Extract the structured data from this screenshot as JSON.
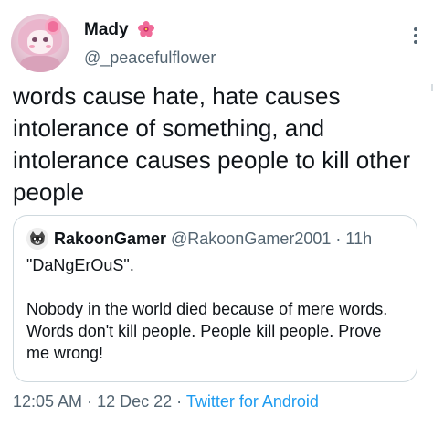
{
  "author": {
    "display_name": "Mady",
    "handle": "@_peacefulflower",
    "name_emoji": "hibiscus-flower"
  },
  "tweet": {
    "text": "words cause hate, hate causes intolerance of something, and intolerance causes people to kill other people"
  },
  "quoted_tweet": {
    "display_name": "RakoonGamer",
    "handle": "@RakoonGamer2001",
    "separator": "·",
    "time_ago": "11h",
    "line_1": "\"DaNgErOuS\".",
    "line_2": "Nobody in the world died because of mere words. Words don't kill people. People kill people. Prove me wrong!"
  },
  "footer": {
    "time": "12:05 AM",
    "separator": "·",
    "date": "12 Dec 22",
    "source": "Twitter for Android"
  },
  "colors": {
    "primary_text": "#0f1419",
    "secondary_text": "#536471",
    "link": "#1d9bf0",
    "border": "#cfd9de",
    "flower": "#ef5d8f"
  }
}
